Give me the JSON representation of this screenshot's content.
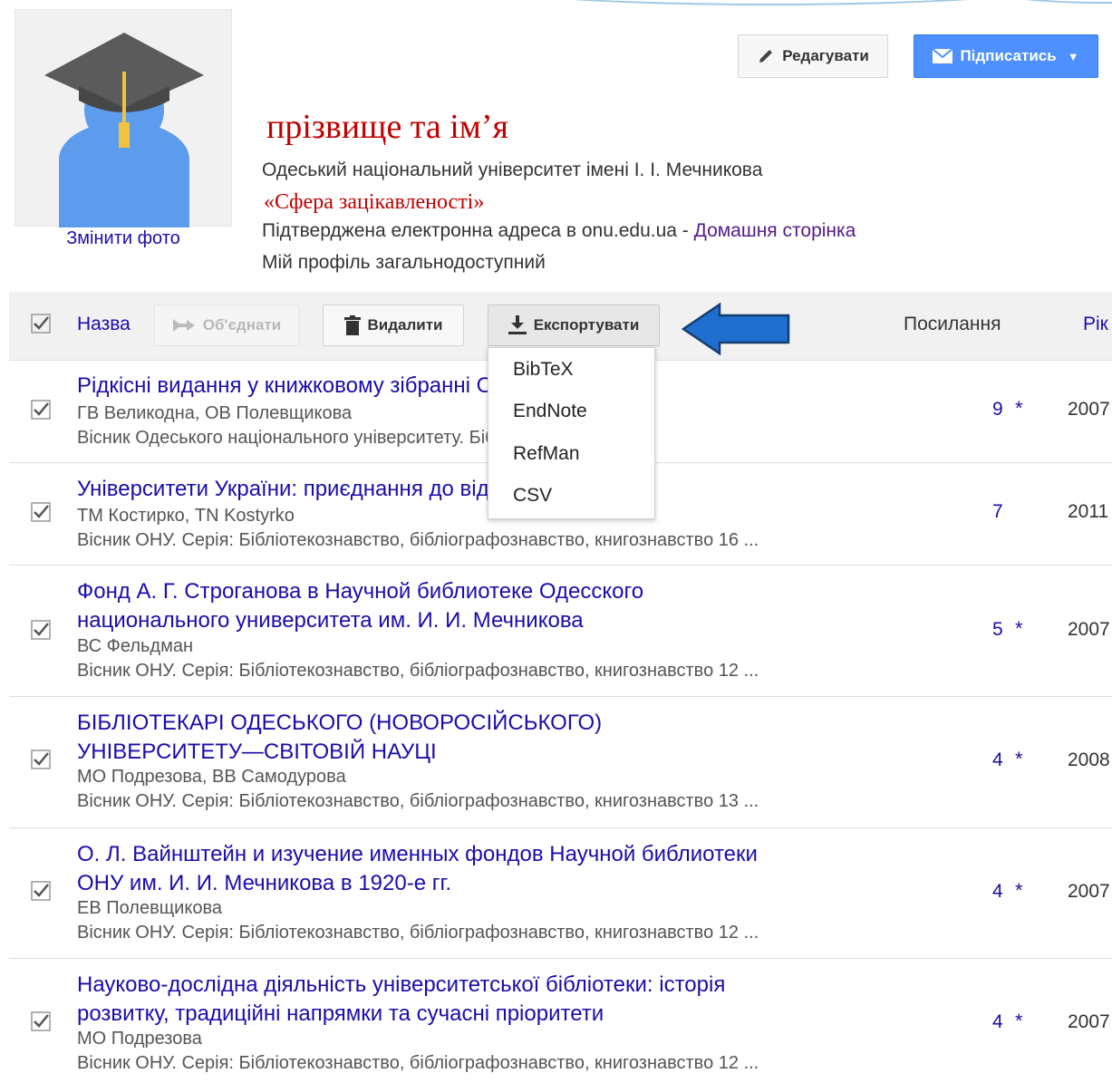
{
  "profile": {
    "change_photo": "Змінити фото",
    "name": "прізвище та ім’я",
    "affiliation": "Одеський національний університет імені І. І. Мечникова",
    "interests": "«Сфера зацікавленості»",
    "email_text": "Підтверджена електронна адреса в onu.edu.ua - ",
    "homepage_link": "Домашня сторінка",
    "public_text": "Мій профіль загальнодоступний"
  },
  "header_buttons": {
    "edit": "Редагувати",
    "subscribe": "Підписатись"
  },
  "toolbar": {
    "title_col": "Назва",
    "merge": "Об'єднати",
    "delete": "Видалити",
    "export": "Експортувати",
    "cites_col": "Посилання",
    "year_col": "Рік"
  },
  "export_menu": [
    "BibTeX",
    "EndNote",
    "RefMan",
    "CSV"
  ],
  "articles": [
    {
      "title_lines": [
        "Рідкісні видання у книжковому зібранні Одеського",
        ""
      ],
      "authors": "ГВ Великодна, ОВ Полевщикова",
      "source": "Вісник Одеського національного університету. Бібліотекознавство ...",
      "cites": "9",
      "star": "*",
      "year": "2007"
    },
    {
      "title_lines": [
        "Університети України: приєднання до відкритого доступу",
        ""
      ],
      "authors": "ТМ Костирко, TN Kostyrko",
      "source": "Вісник ОНУ. Серія: Бібліотекознавство, бібліографознавство, книгознавство 16 ...",
      "cites": "7",
      "star": "",
      "year": "2011"
    },
    {
      "title_lines": [
        "Фонд А. Г. Строганова в Научной библиотеке Одесского",
        "национального университета им. И. И. Мечникова"
      ],
      "authors": "ВС Фельдман",
      "source": "Вісник ОНУ. Серія: Бібліотекознавство, бібліографознавство, книгознавство 12 ...",
      "cites": "5",
      "star": "*",
      "year": "2007"
    },
    {
      "title_lines": [
        "БІБЛІОТЕКАРІ ОДЕСЬКОГО (НОВОРОСІЙСЬКОГО)",
        "УНІВЕРСИТЕТУ—СВІТОВІЙ НАУЦІ"
      ],
      "authors": "МО Подрезова, ВВ Самодурова",
      "source": "Вісник ОНУ. Серія: Бібліотекознавство, бібліографознавство, книгознавство 13 ...",
      "cites": "4",
      "star": "*",
      "year": "2008"
    },
    {
      "title_lines": [
        "О. Л. Вайнштейн и изучение именных фондов Научной библиотеки",
        "ОНУ им. И. И. Мечникова в 1920-е гг."
      ],
      "authors": "ЕВ Полевщикова",
      "source": "Вісник ОНУ. Серія: Бібліотекознавство, бібліографознавство, книгознавство 12 ...",
      "cites": "4",
      "star": "*",
      "year": "2007"
    },
    {
      "title_lines": [
        "Науково-дослідна діяльність університетської бібліотеки: історія",
        "розвитку, традиційні напрямки та сучасні пріоритети"
      ],
      "authors": "МО Подрезова",
      "source": "Вісник ОНУ. Серія: Бібліотекознавство, бібліографознавство, книгознавство 12 ...",
      "cites": "4",
      "star": "*",
      "year": "2007"
    }
  ]
}
